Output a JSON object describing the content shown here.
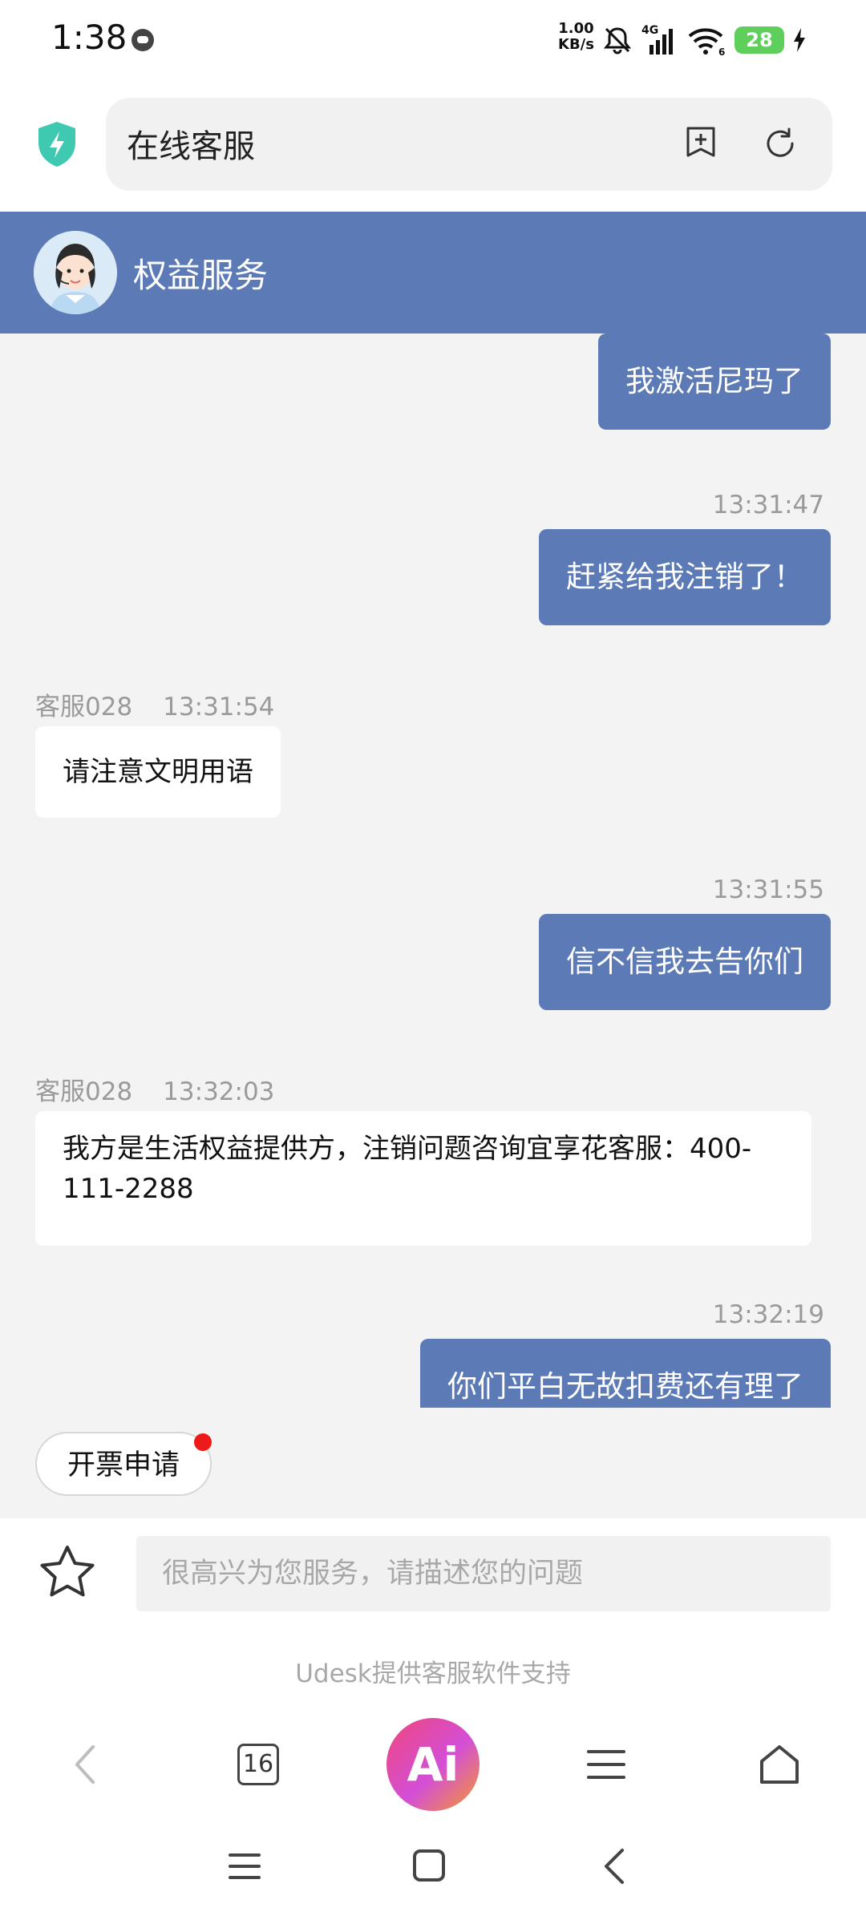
{
  "status_bar": {
    "time": "1:38",
    "speed_value": "1.00",
    "speed_unit": "KB/s",
    "network": "4G",
    "wifi_badge": "6",
    "battery": "28"
  },
  "browser": {
    "page_title": "在线客服"
  },
  "chat_header": {
    "title": "权益服务"
  },
  "messages": [
    {
      "side": "right",
      "text": "我激活尼玛了"
    },
    {
      "side": "right",
      "time": "13:31:47",
      "text": "赶紧给我注销了！"
    },
    {
      "side": "left",
      "agent": "客服028",
      "time": "13:31:54",
      "text": "请注意文明用语"
    },
    {
      "side": "right",
      "time": "13:31:55",
      "text": "信不信我去告你们"
    },
    {
      "side": "left",
      "agent": "客服028",
      "time": "13:32:03",
      "text_line1": "我方是生活权益提供方，注销问题咨询宜享花客服：400-",
      "text_line2": "111-2288"
    },
    {
      "side": "right",
      "time": "13:32:19",
      "text": "你们平白无故扣费还有理了"
    }
  ],
  "quick_actions": {
    "invoice_label": "开票申请"
  },
  "input": {
    "placeholder": "很高兴为您服务，请描述您的问题",
    "powered_by": "Udesk提供客服软件支持"
  },
  "bottom_nav": {
    "tab_count": "16",
    "ai_label": "Ai"
  },
  "icons": {
    "shield": "shield-icon",
    "add_bookmark": "add-bookmark-icon",
    "refresh": "refresh-icon",
    "star": "star-icon",
    "back": "chevron-left-icon",
    "menu": "menu-icon",
    "home": "home-icon"
  },
  "colors": {
    "accent": "#5b7ab6",
    "shield": "#3ec9b0",
    "notification_dot": "#ee1a1a",
    "battery": "#5fcf5c"
  }
}
